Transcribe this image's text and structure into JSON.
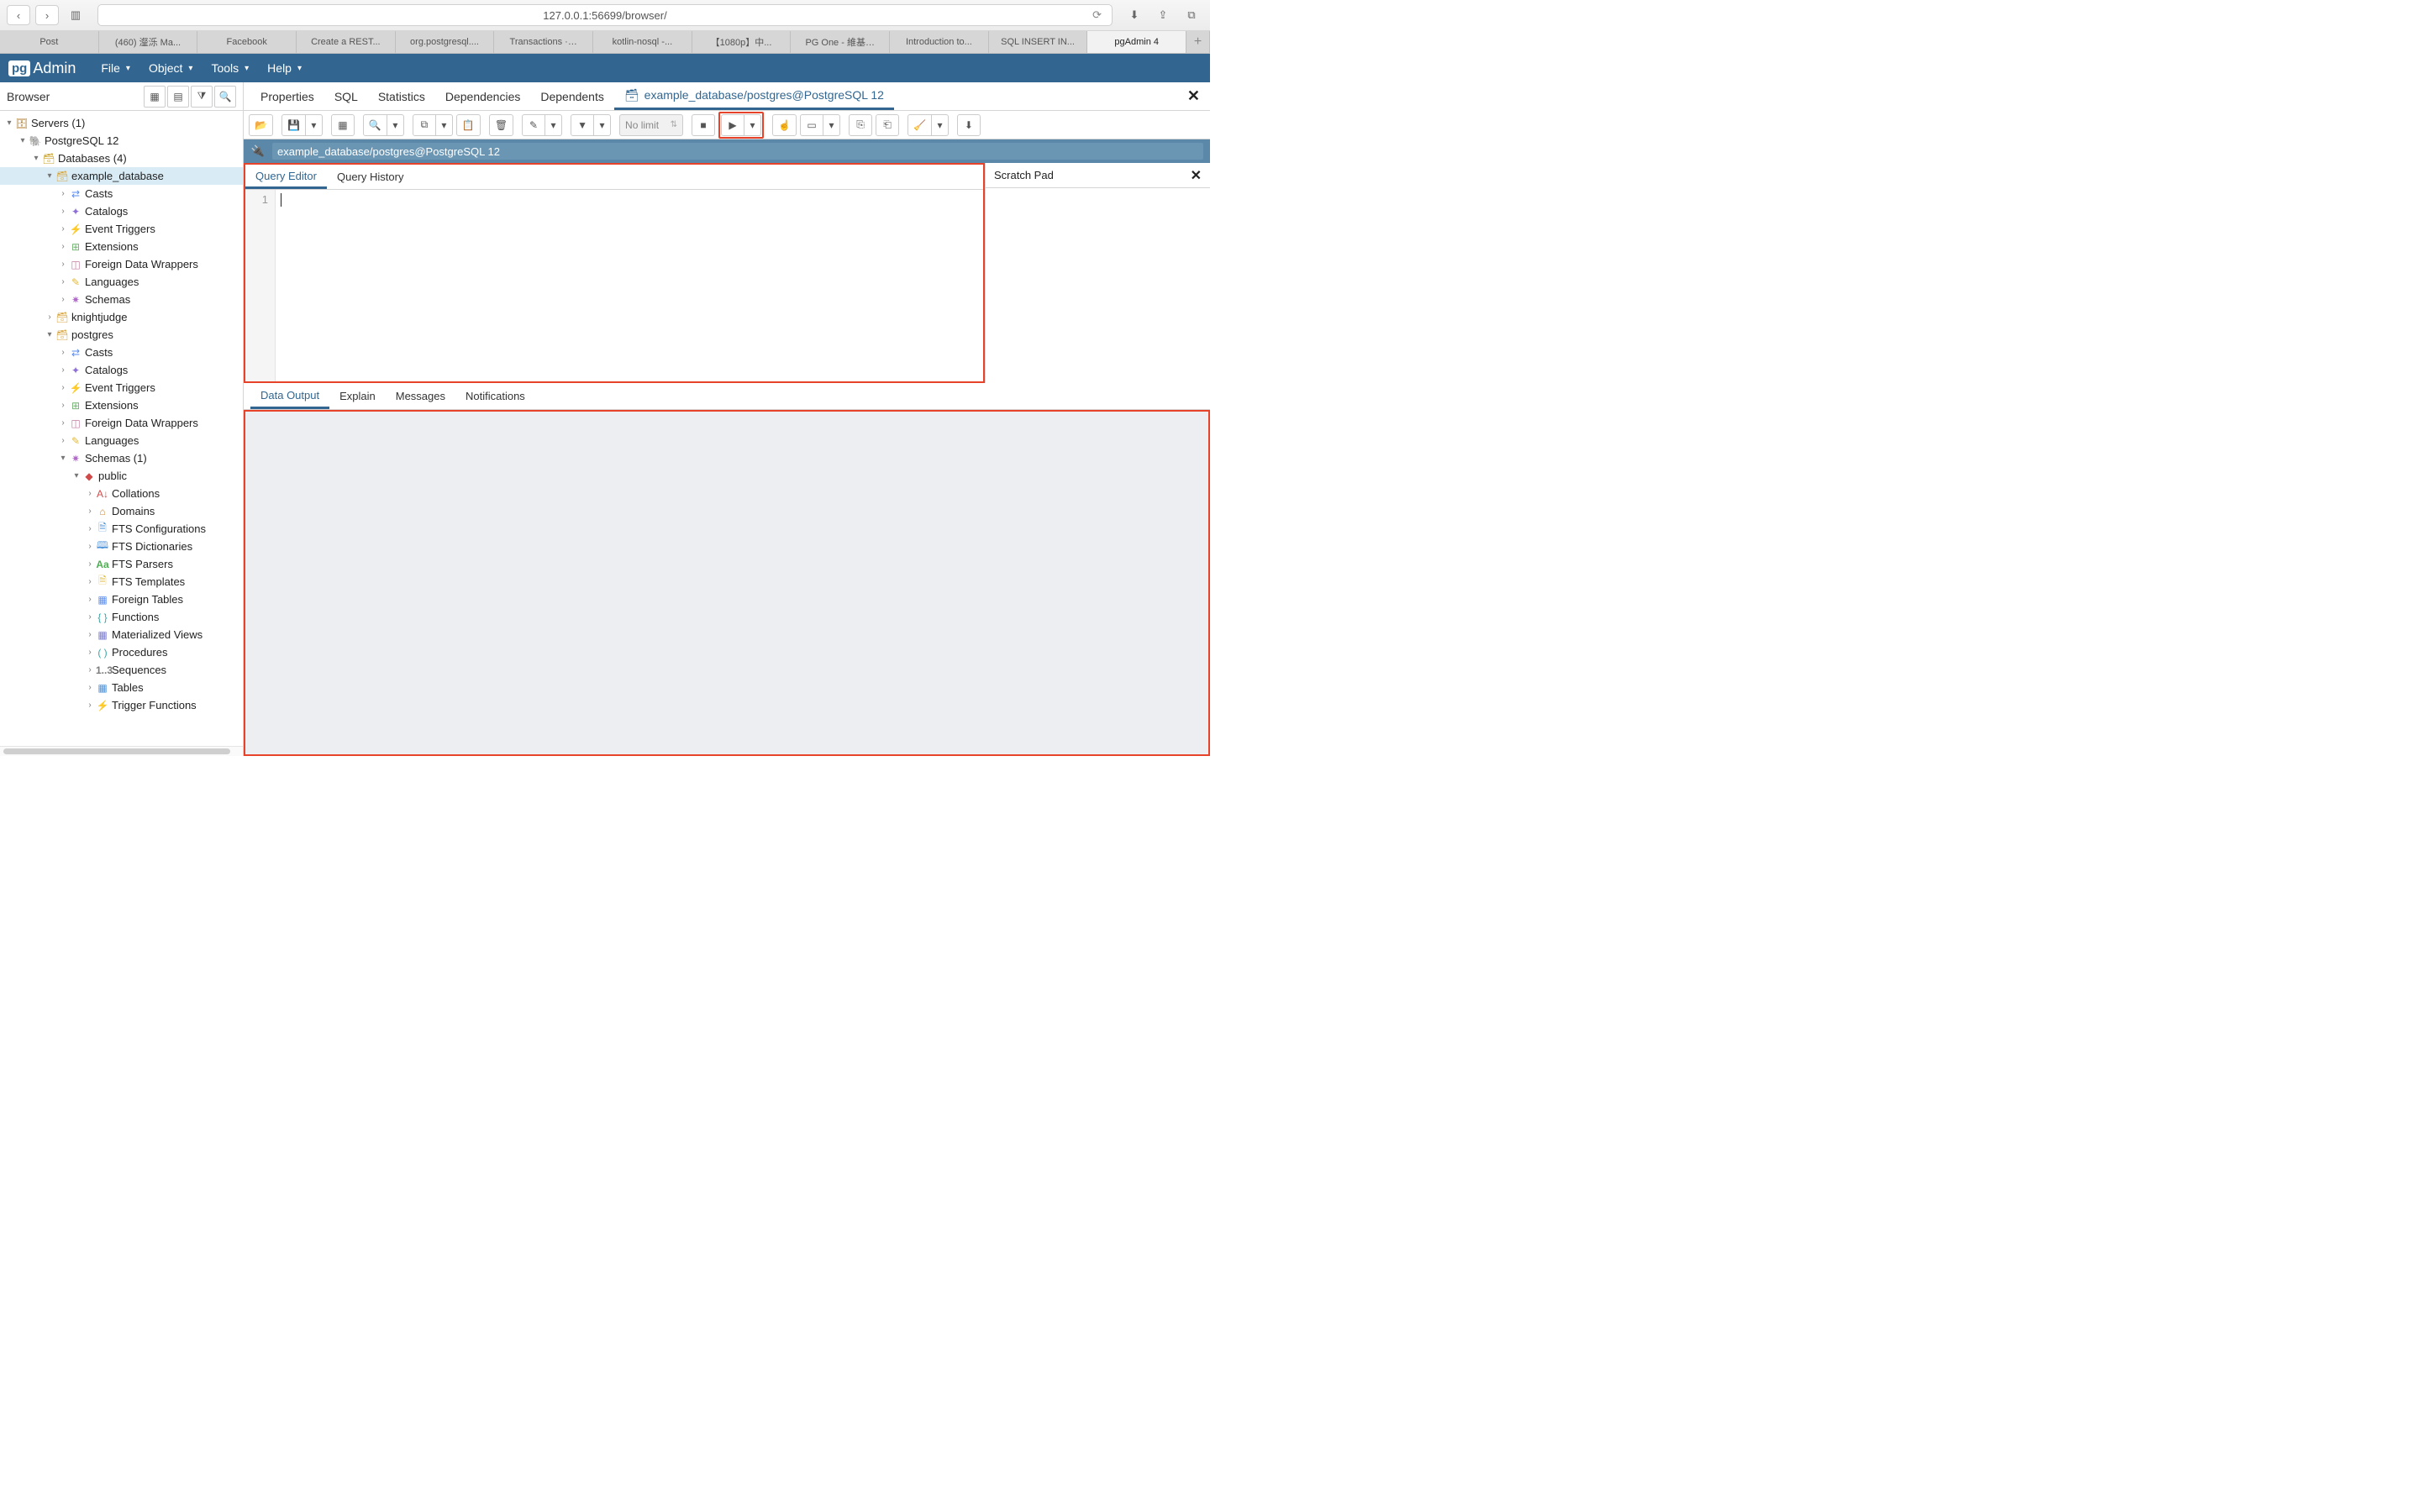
{
  "safari": {
    "address": "127.0.0.1:56699/browser/",
    "tabs": [
      "Post",
      "(460) 瀣泺 Ma...",
      "Facebook",
      "Create a REST...",
      "org.postgresql....",
      "Transactions ·…",
      "kotlin-nosql -...",
      "【1080p】中...",
      "PG One - 維基…",
      "Introduction to...",
      "SQL INSERT IN...",
      "pgAdmin 4"
    ],
    "active_tab_index": 11
  },
  "menubar": {
    "logo_pg": "pg",
    "logo_admin": "Admin",
    "items": [
      "File",
      "Object",
      "Tools",
      "Help"
    ]
  },
  "sidebar": {
    "title": "Browser",
    "tree": {
      "servers": "Servers (1)",
      "pg12": "PostgreSQL 12",
      "databases": "Databases (4)",
      "example_db": "example_database",
      "casts": "Casts",
      "catalogs": "Catalogs",
      "event_triggers": "Event Triggers",
      "extensions": "Extensions",
      "fdw": "Foreign Data Wrappers",
      "languages": "Languages",
      "schemas": "Schemas",
      "knightjudge": "knightjudge",
      "postgres": "postgres",
      "schemas1": "Schemas (1)",
      "public": "public",
      "collations": "Collations",
      "domains": "Domains",
      "fts_conf": "FTS Configurations",
      "fts_dict": "FTS Dictionaries",
      "fts_parsers": "FTS Parsers",
      "fts_tpl": "FTS Templates",
      "foreign_tables": "Foreign Tables",
      "functions": "Functions",
      "mviews": "Materialized Views",
      "procedures": "Procedures",
      "sequences": "Sequences",
      "tables": "Tables",
      "trigger_functions": "Trigger Functions"
    }
  },
  "tabs": {
    "properties": "Properties",
    "sql": "SQL",
    "statistics": "Statistics",
    "dependencies": "Dependencies",
    "dependents": "Dependents",
    "query_tab": "example_database/postgres@PostgreSQL 12"
  },
  "toolbar": {
    "limit": "No limit"
  },
  "conn": {
    "label": "example_database/postgres@PostgreSQL 12"
  },
  "editor": {
    "tabs": {
      "query_editor": "Query Editor",
      "query_history": "Query History"
    },
    "line_number": "1",
    "scratch": "Scratch Pad"
  },
  "output_tabs": {
    "data_output": "Data Output",
    "explain": "Explain",
    "messages": "Messages",
    "notifications": "Notifications"
  }
}
